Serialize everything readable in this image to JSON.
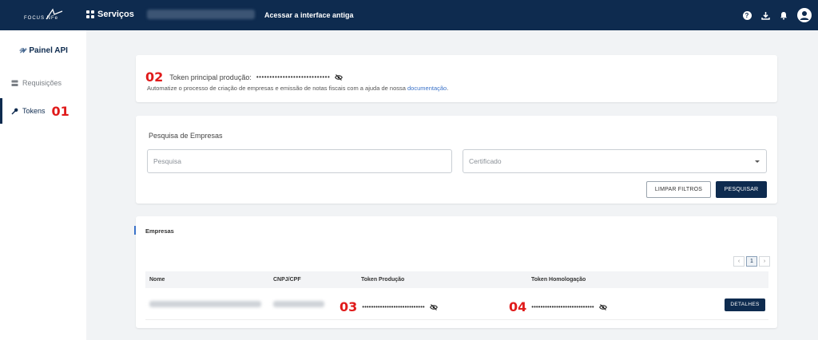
{
  "colors": {
    "primary": "#0e2b4f",
    "annotation": "#e01b1b",
    "link": "#3b73c9"
  },
  "header": {
    "logo_text": "FOCUS",
    "logo_suffix": "NFe",
    "services_label": "Serviços",
    "old_interface_label": "Acessar a interface antiga",
    "icons": [
      "help-icon",
      "download-icon",
      "bell-icon",
      "user-icon"
    ]
  },
  "sidebar": {
    "title": "Painel API",
    "items": [
      {
        "label": "Requisições",
        "icon": "server-icon"
      },
      {
        "label": "Tokens",
        "icon": "key-icon",
        "annotation": "01"
      }
    ]
  },
  "token_card": {
    "annotation": "02",
    "label": "Token principal produção:",
    "masked_value": "••••••••••••••••••••••••••••",
    "description": "Automatize o processo de criação de empresas e emissão de notas fiscais com a ajuda de nossa ",
    "link_text": "documentação",
    "trailing": "."
  },
  "search": {
    "title": "Pesquisa de Empresas",
    "search_placeholder": "Pesquisa",
    "certificate_placeholder": "Certificado",
    "clear_label": "LIMPAR FILTROS",
    "search_label": "PESQUISAR"
  },
  "companies": {
    "title": "Empresas",
    "pagination": {
      "prev": "‹",
      "current": "1",
      "next": "›"
    },
    "columns": [
      "Nome",
      "CNPJ/CPF",
      "Token Produção",
      "Token Homologação"
    ],
    "rows": [
      {
        "production_annotation": "03",
        "production_token": "••••••••••••••••••••••••••••",
        "homologation_annotation": "04",
        "homologation_token": "••••••••••••••••••••••••••••",
        "details_label": "DETALHES"
      }
    ]
  }
}
